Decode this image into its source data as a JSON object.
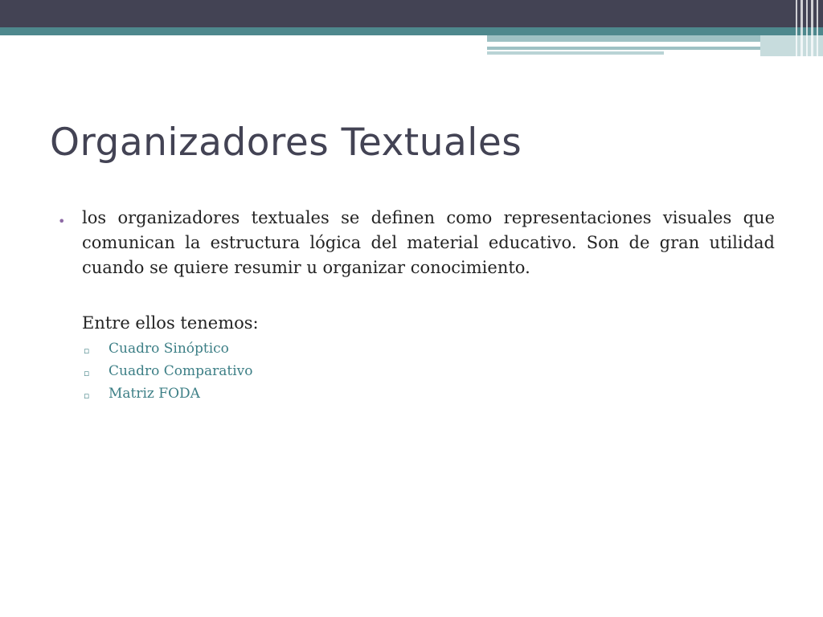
{
  "slide": {
    "title": "Organizadores Textuales",
    "bullet_symbol": "•",
    "paragraph": "los organizadores textuales se definen como representaciones visuales que comunican la estructura lógica del material educativo. Son de gran utilidad cuando se quiere resumir u organizar conocimiento.",
    "subheading": "Entre ellos tenemos:",
    "sub_marker": "▫",
    "items": [
      {
        "label": "Cuadro Sinóptico"
      },
      {
        "label": "Cuadro Comparativo"
      },
      {
        "label": "Matriz FODA"
      }
    ]
  },
  "colors": {
    "header_dark": "#434354",
    "header_teal": "#4e888d",
    "title": "#434354",
    "bullet": "#8e6aa6",
    "sub_items": "#3d7f86"
  }
}
